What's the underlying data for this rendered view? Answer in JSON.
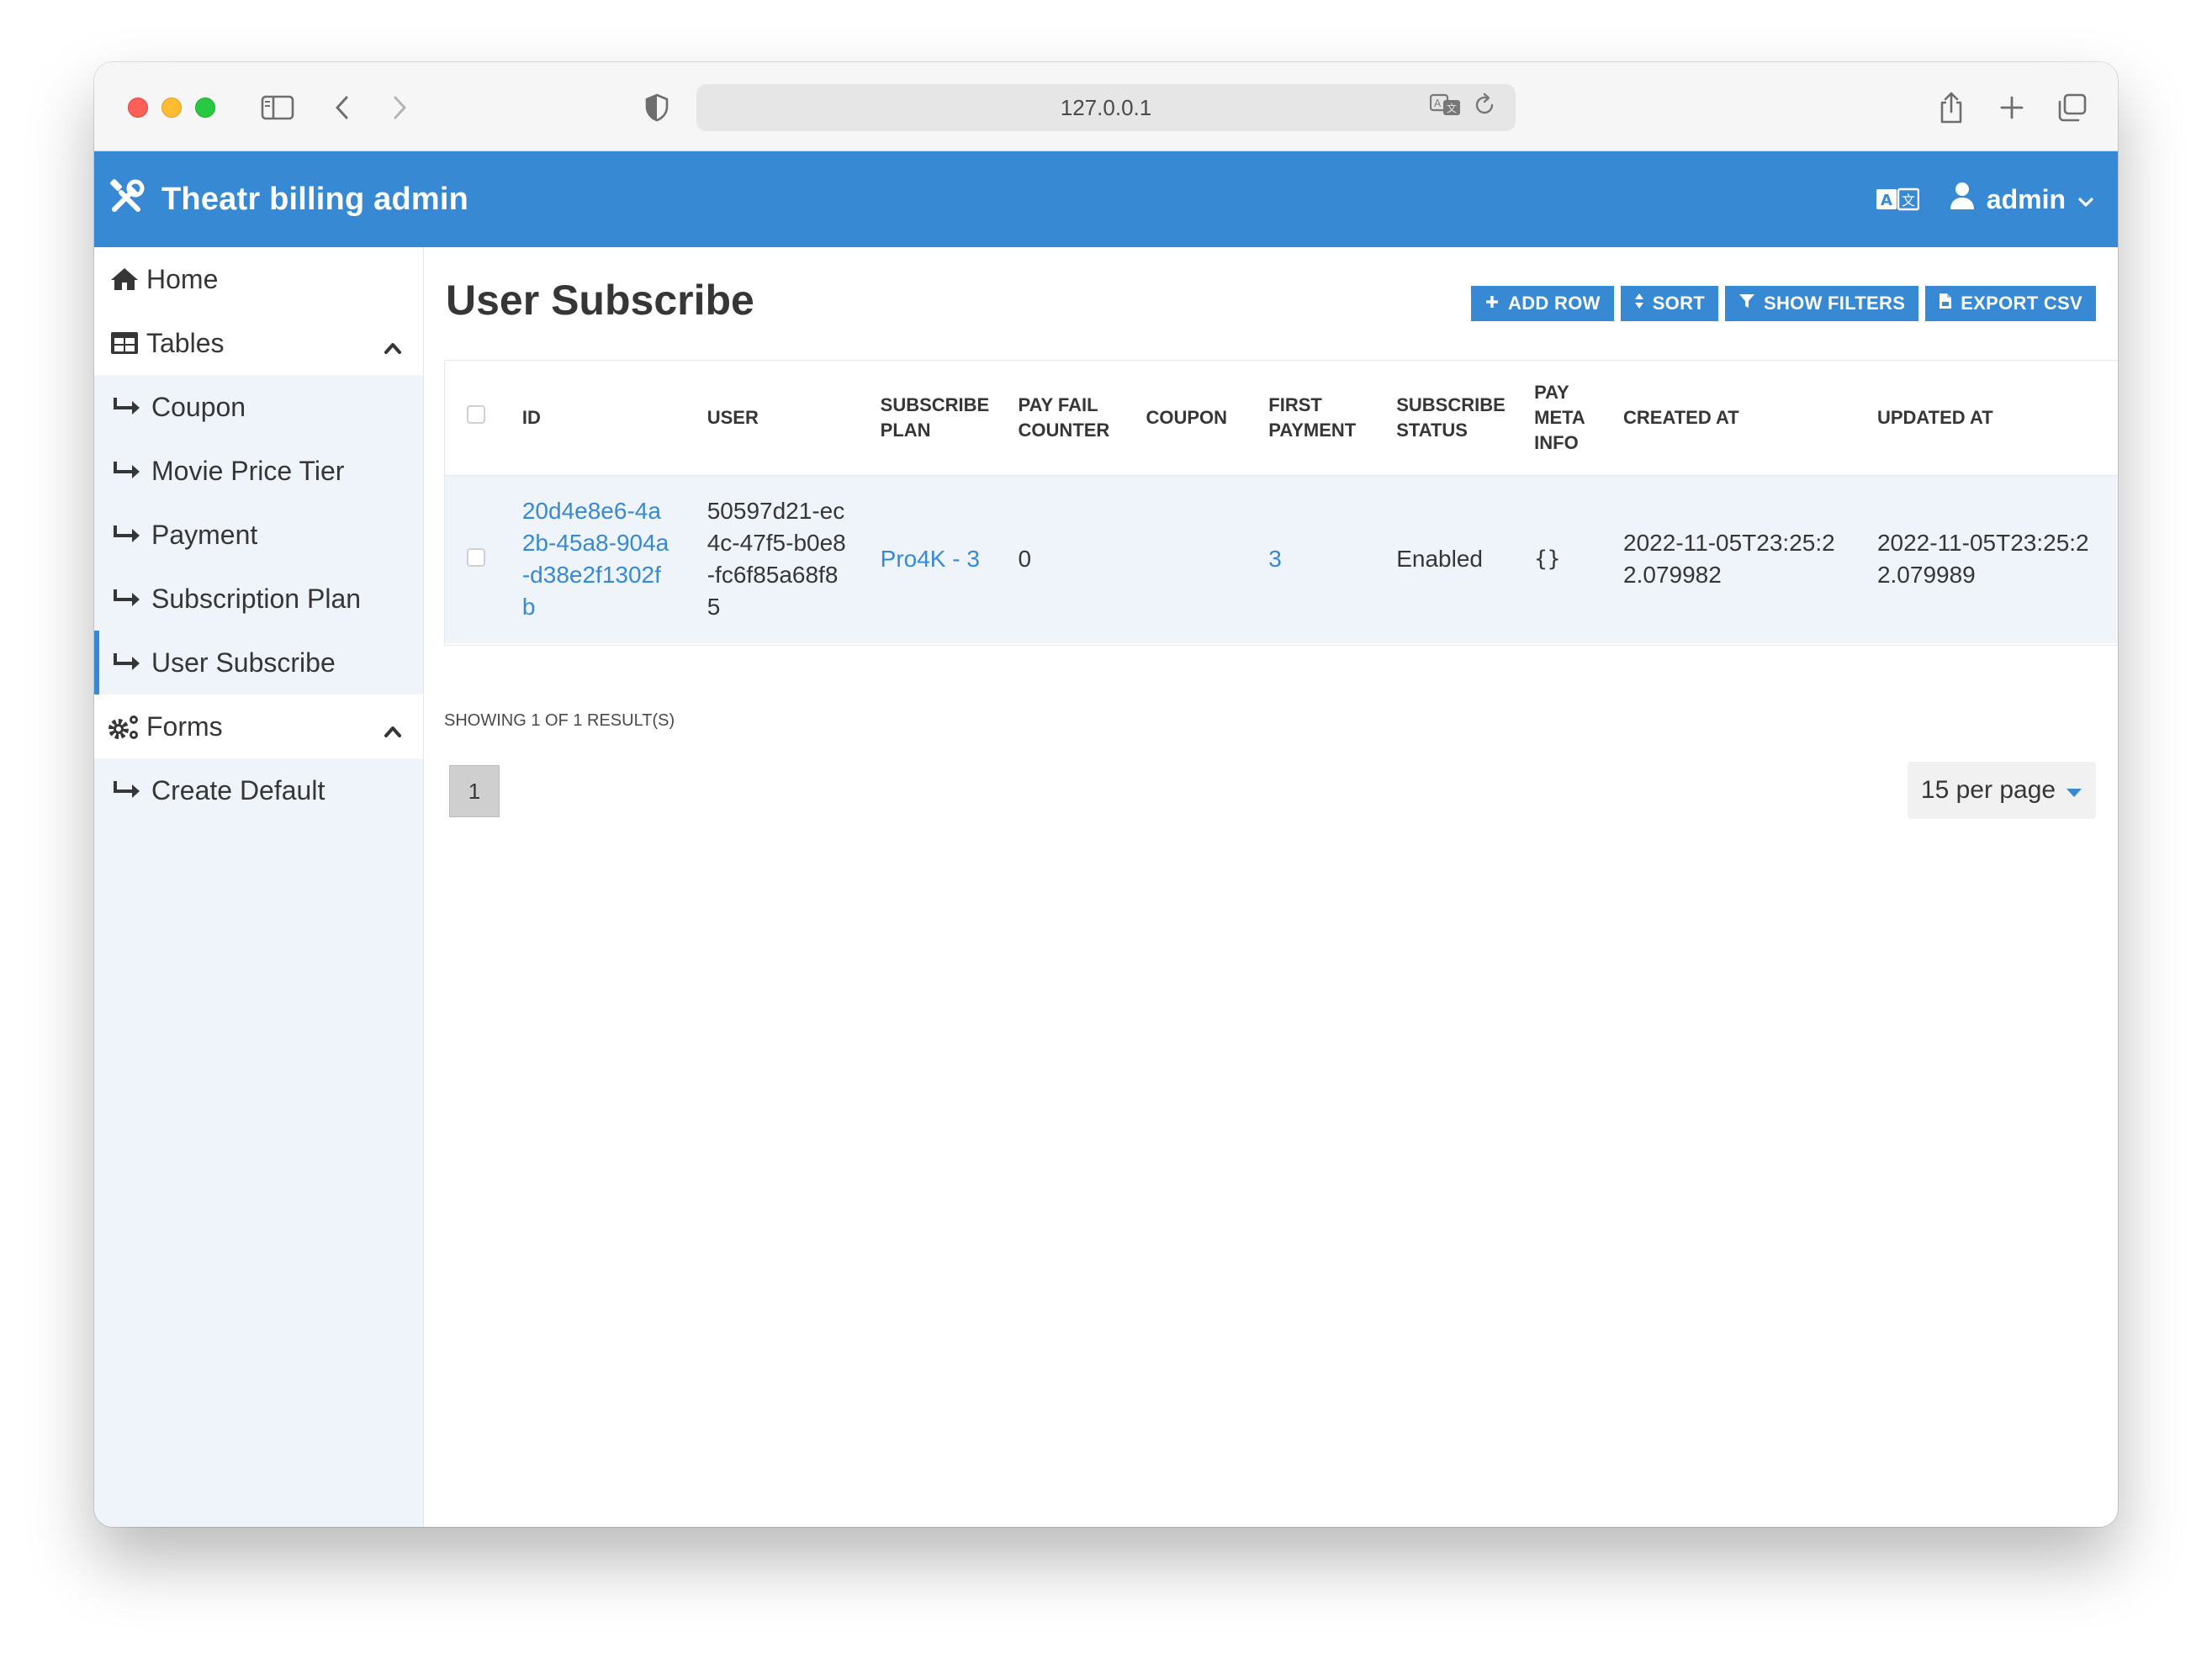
{
  "browser": {
    "url": "127.0.0.1"
  },
  "header": {
    "brand": "Theatr billing admin",
    "user_label": "admin"
  },
  "sidebar": {
    "home": "Home",
    "tables_label": "Tables",
    "table_items": [
      {
        "label": "Coupon"
      },
      {
        "label": "Movie Price Tier"
      },
      {
        "label": "Payment"
      },
      {
        "label": "Subscription Plan"
      },
      {
        "label": "User Subscribe"
      }
    ],
    "forms_label": "Forms",
    "form_items": [
      {
        "label": "Create Default"
      }
    ],
    "active_item": "User Subscribe"
  },
  "main": {
    "title": "User Subscribe",
    "toolbar": {
      "add_row": "ADD ROW",
      "sort": "SORT",
      "show_filters": "SHOW FILTERS",
      "export_csv": "EXPORT CSV"
    },
    "table": {
      "columns": [
        "ID",
        "USER",
        "SUBSCRIBE PLAN",
        "PAY FAIL COUNTER",
        "COUPON",
        "FIRST PAYMENT",
        "SUBSCRIBE STATUS",
        "PAY META INFO",
        "CREATED AT",
        "UPDATED AT"
      ],
      "rows": [
        {
          "id": "20d4e8e6-4a2b-45a8-904a-d38e2f1302fb",
          "user": "50597d21-ec4c-47f5-b0e8-fc6f85a68f85",
          "subscribe_plan": "Pro4K - 3",
          "pay_fail_counter": "0",
          "coupon": "",
          "first_payment": "3",
          "subscribe_status": "Enabled",
          "pay_meta_info": "{}",
          "created_at": "2022-11-05T23:25:22.079982",
          "updated_at": "2022-11-05T23:25:22.079989"
        }
      ]
    },
    "showing": "SHOWING 1 OF 1 RESULT(S)",
    "pagination": {
      "current_page": "1",
      "per_page": "15 per page"
    }
  },
  "colors": {
    "accent": "#3889d4",
    "sidebar_bg": "#eef4f9",
    "row_bg": "#eef4f9"
  }
}
